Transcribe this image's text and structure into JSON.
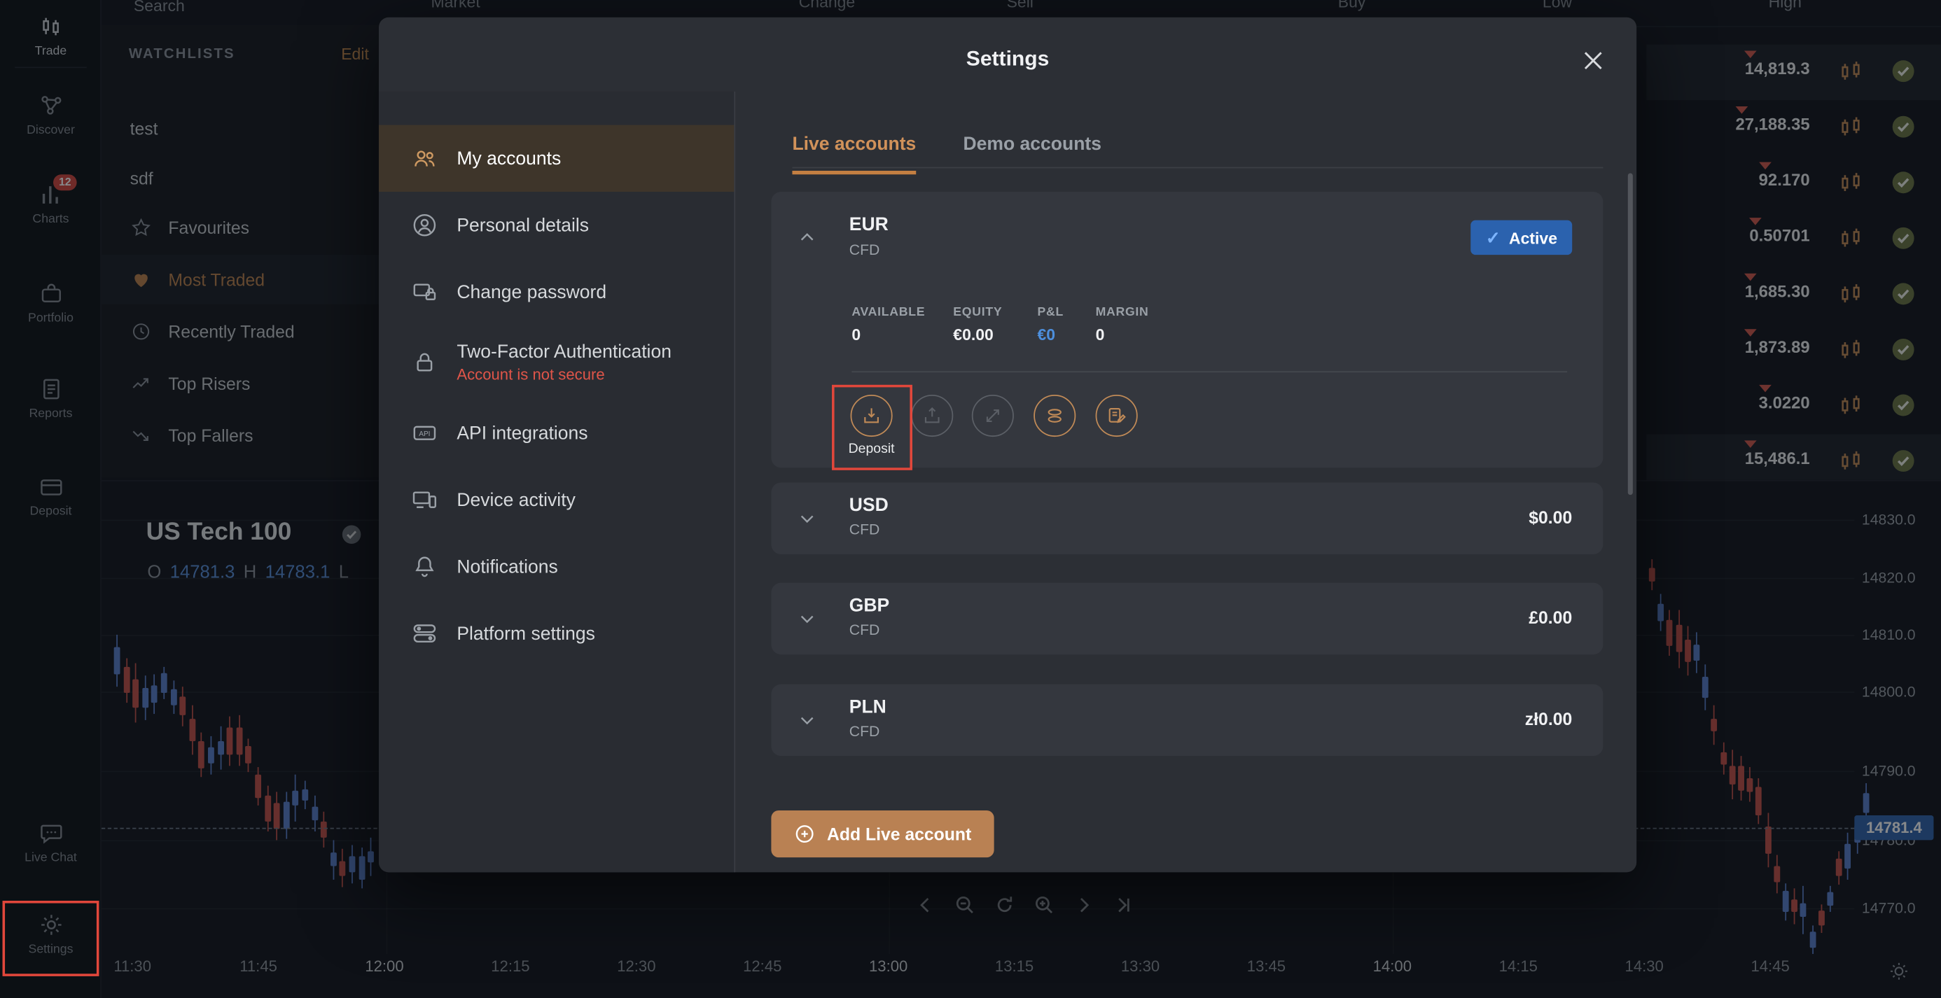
{
  "topbar": {
    "search_placeholder": "Search",
    "columns": [
      "Market",
      "Change",
      "Sell",
      "Buy",
      "Low",
      "High"
    ]
  },
  "sidebar": {
    "items": [
      {
        "label": "Trade"
      },
      {
        "label": "Discover"
      },
      {
        "label": "Charts",
        "badge": "12"
      },
      {
        "label": "Portfolio"
      },
      {
        "label": "Reports"
      },
      {
        "label": "Deposit"
      },
      {
        "label": "Live Chat"
      },
      {
        "label": "Settings"
      }
    ]
  },
  "watchlists": {
    "title": "WATCHLISTS",
    "edit_label": "Edit",
    "items": [
      {
        "label": "test"
      },
      {
        "label": "sdf"
      },
      {
        "label": "Favourites"
      },
      {
        "label": "Most Traded"
      },
      {
        "label": "Recently Traded"
      },
      {
        "label": "Top Risers"
      },
      {
        "label": "Top Fallers"
      }
    ]
  },
  "market_table": {
    "rows": [
      {
        "value": "14,819.3"
      },
      {
        "value": "27,188.35"
      },
      {
        "value": "92.170"
      },
      {
        "value": "0.50701"
      },
      {
        "value": "1,685.30"
      },
      {
        "value": "1,873.89"
      },
      {
        "value": "3.0220"
      },
      {
        "value": "15,486.1"
      }
    ]
  },
  "chart": {
    "title": "US Tech 100",
    "open_label": "O",
    "open_value": "14781.3",
    "high_label": "H",
    "high_value": "14783.1",
    "low_label": "L",
    "last_price": "14781.4",
    "price_axis": [
      "14830.0",
      "14820.0",
      "14810.0",
      "14800.0",
      "14790.0",
      "14780.0",
      "14770.0"
    ],
    "time_axis": [
      "11:30",
      "11:45",
      "12:00",
      "12:15",
      "12:30",
      "12:45",
      "13:00",
      "13:15",
      "13:30",
      "13:45",
      "14:00",
      "14:15",
      "14:30",
      "14:45"
    ]
  },
  "settings_modal": {
    "title": "Settings",
    "menu": [
      {
        "label": "My accounts"
      },
      {
        "label": "Personal details"
      },
      {
        "label": "Change password"
      },
      {
        "label": "Two-Factor Authentication",
        "sublabel": "Account is not secure"
      },
      {
        "label": "API integrations"
      },
      {
        "label": "Device activity"
      },
      {
        "label": "Notifications"
      },
      {
        "label": "Platform settings"
      }
    ],
    "tabs": [
      {
        "label": "Live accounts"
      },
      {
        "label": "Demo accounts"
      }
    ],
    "eur_account": {
      "currency": "EUR",
      "type": "CFD",
      "status": "Active",
      "stats": [
        {
          "label": "AVAILABLE",
          "value": "0"
        },
        {
          "label": "EQUITY",
          "value": "€0.00"
        },
        {
          "label": "P&L",
          "value": "€0"
        },
        {
          "label": "MARGIN",
          "value": "0"
        }
      ],
      "deposit_label": "Deposit"
    },
    "accounts": [
      {
        "currency": "USD",
        "type": "CFD",
        "balance": "$0.00"
      },
      {
        "currency": "GBP",
        "type": "CFD",
        "balance": "£0.00"
      },
      {
        "currency": "PLN",
        "type": "CFD",
        "balance": "zł0.00"
      }
    ],
    "add_account_label": "Add Live account"
  }
}
